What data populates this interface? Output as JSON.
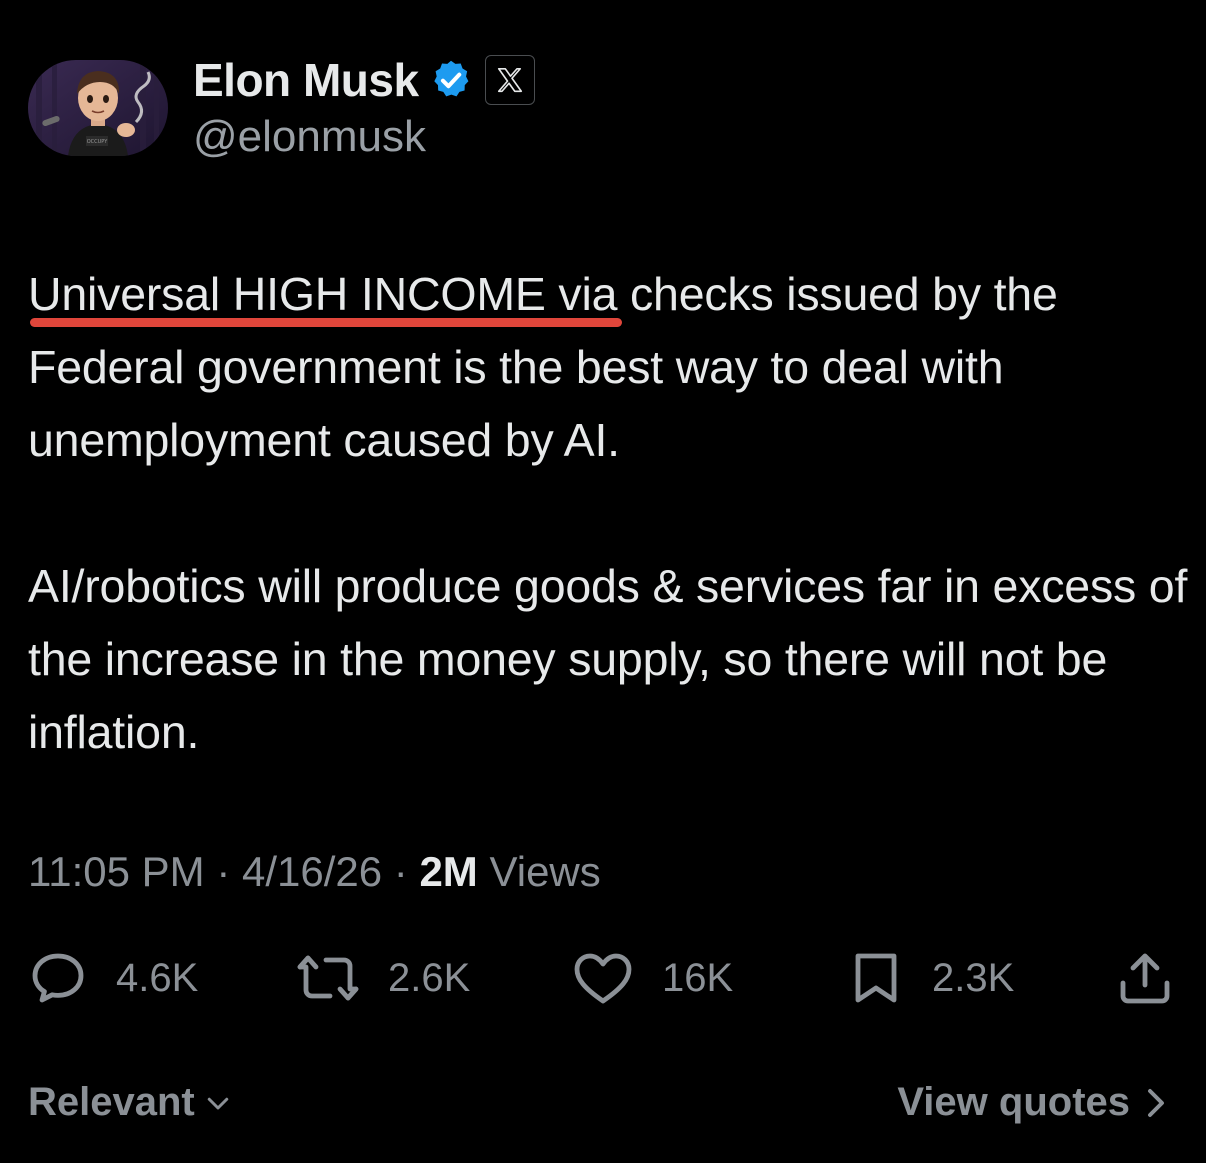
{
  "author": {
    "display_name": "Elon Musk",
    "handle": "@elonmusk",
    "verified_icon": "verified-badge-icon",
    "affiliate_icon": "x-logo-icon"
  },
  "tweet": {
    "paragraphs": [
      {
        "highlight": "Universal HIGH INCOME",
        "rest": " via checks issued by the Federal government is the best way to deal with unemployment caused by AI."
      },
      {
        "text": "AI/robotics will produce goods & services far in excess of the increase in the money supply, so there will not be inflation."
      }
    ],
    "highlight_color": "#e0463b"
  },
  "meta": {
    "time": "11:05 PM",
    "separator": " · ",
    "date": "4/16/26",
    "views_count": "2M",
    "views_label": " Views"
  },
  "actions": {
    "replies": "4.6K",
    "reposts": "2.6K",
    "likes": "16K",
    "bookmarks": "2.3K"
  },
  "footer": {
    "sort_label": "Relevant",
    "view_quotes_label": "View quotes"
  },
  "colors": {
    "background": "#000000",
    "text": "#e7e9ea",
    "secondary": "#8b9096",
    "verified_blue": "#1d9bf0"
  }
}
